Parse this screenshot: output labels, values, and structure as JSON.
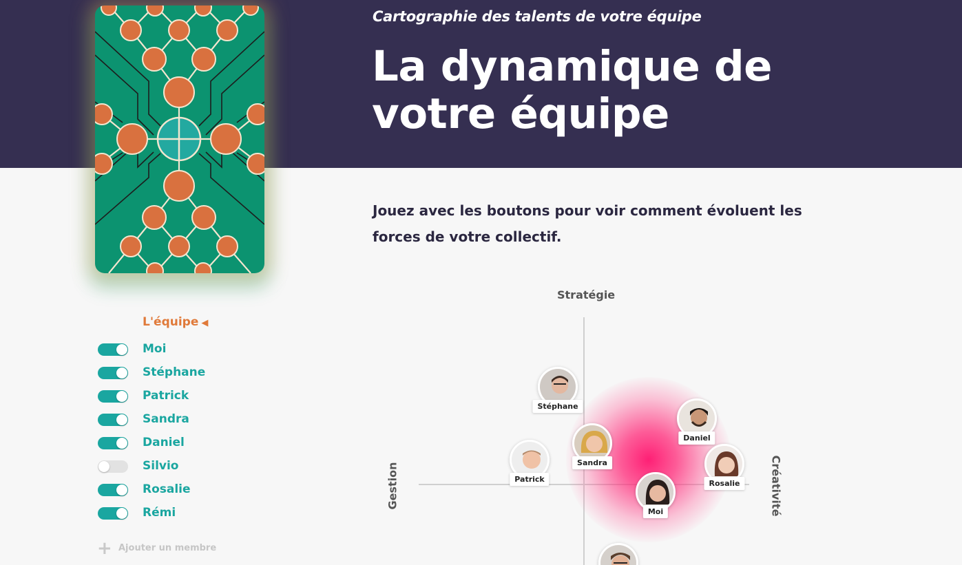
{
  "header": {
    "subtitle": "Cartographie des talents de votre équipe",
    "title": "La dynamique de votre équipe",
    "background_color": "#352f51"
  },
  "intro": {
    "text": "Jouez avec les boutons pour voir comment évoluent les forces de votre collectif."
  },
  "card": {
    "icon": "talent-card-pattern",
    "background_color": "#0c9370",
    "accent_color": "#d9713f"
  },
  "team": {
    "heading": "L'équipe",
    "heading_icon": "chevron-left-icon",
    "heading_color": "#e07a3a",
    "members": [
      {
        "name": "Moi",
        "enabled": true
      },
      {
        "name": "Stéphane",
        "enabled": true
      },
      {
        "name": "Patrick",
        "enabled": true
      },
      {
        "name": "Sandra",
        "enabled": true
      },
      {
        "name": "Daniel",
        "enabled": true
      },
      {
        "name": "Silvio",
        "enabled": false
      },
      {
        "name": "Rosalie",
        "enabled": true
      },
      {
        "name": "Rémi",
        "enabled": true
      }
    ],
    "add_label": "Ajouter un membre",
    "add_icon": "plus-icon",
    "toggle_on_color": "#1aa6a0"
  },
  "map": {
    "axis_top": "Stratégie",
    "axis_left": "Gestion",
    "axis_right": "Créativité",
    "people": [
      {
        "label": "Stéphane"
      },
      {
        "label": "Daniel"
      },
      {
        "label": "Sandra"
      },
      {
        "label": "Patrick"
      },
      {
        "label": "Rosalie"
      },
      {
        "label": "Moi"
      },
      {
        "label": ""
      }
    ],
    "glow_color": "#ff1a6e"
  }
}
